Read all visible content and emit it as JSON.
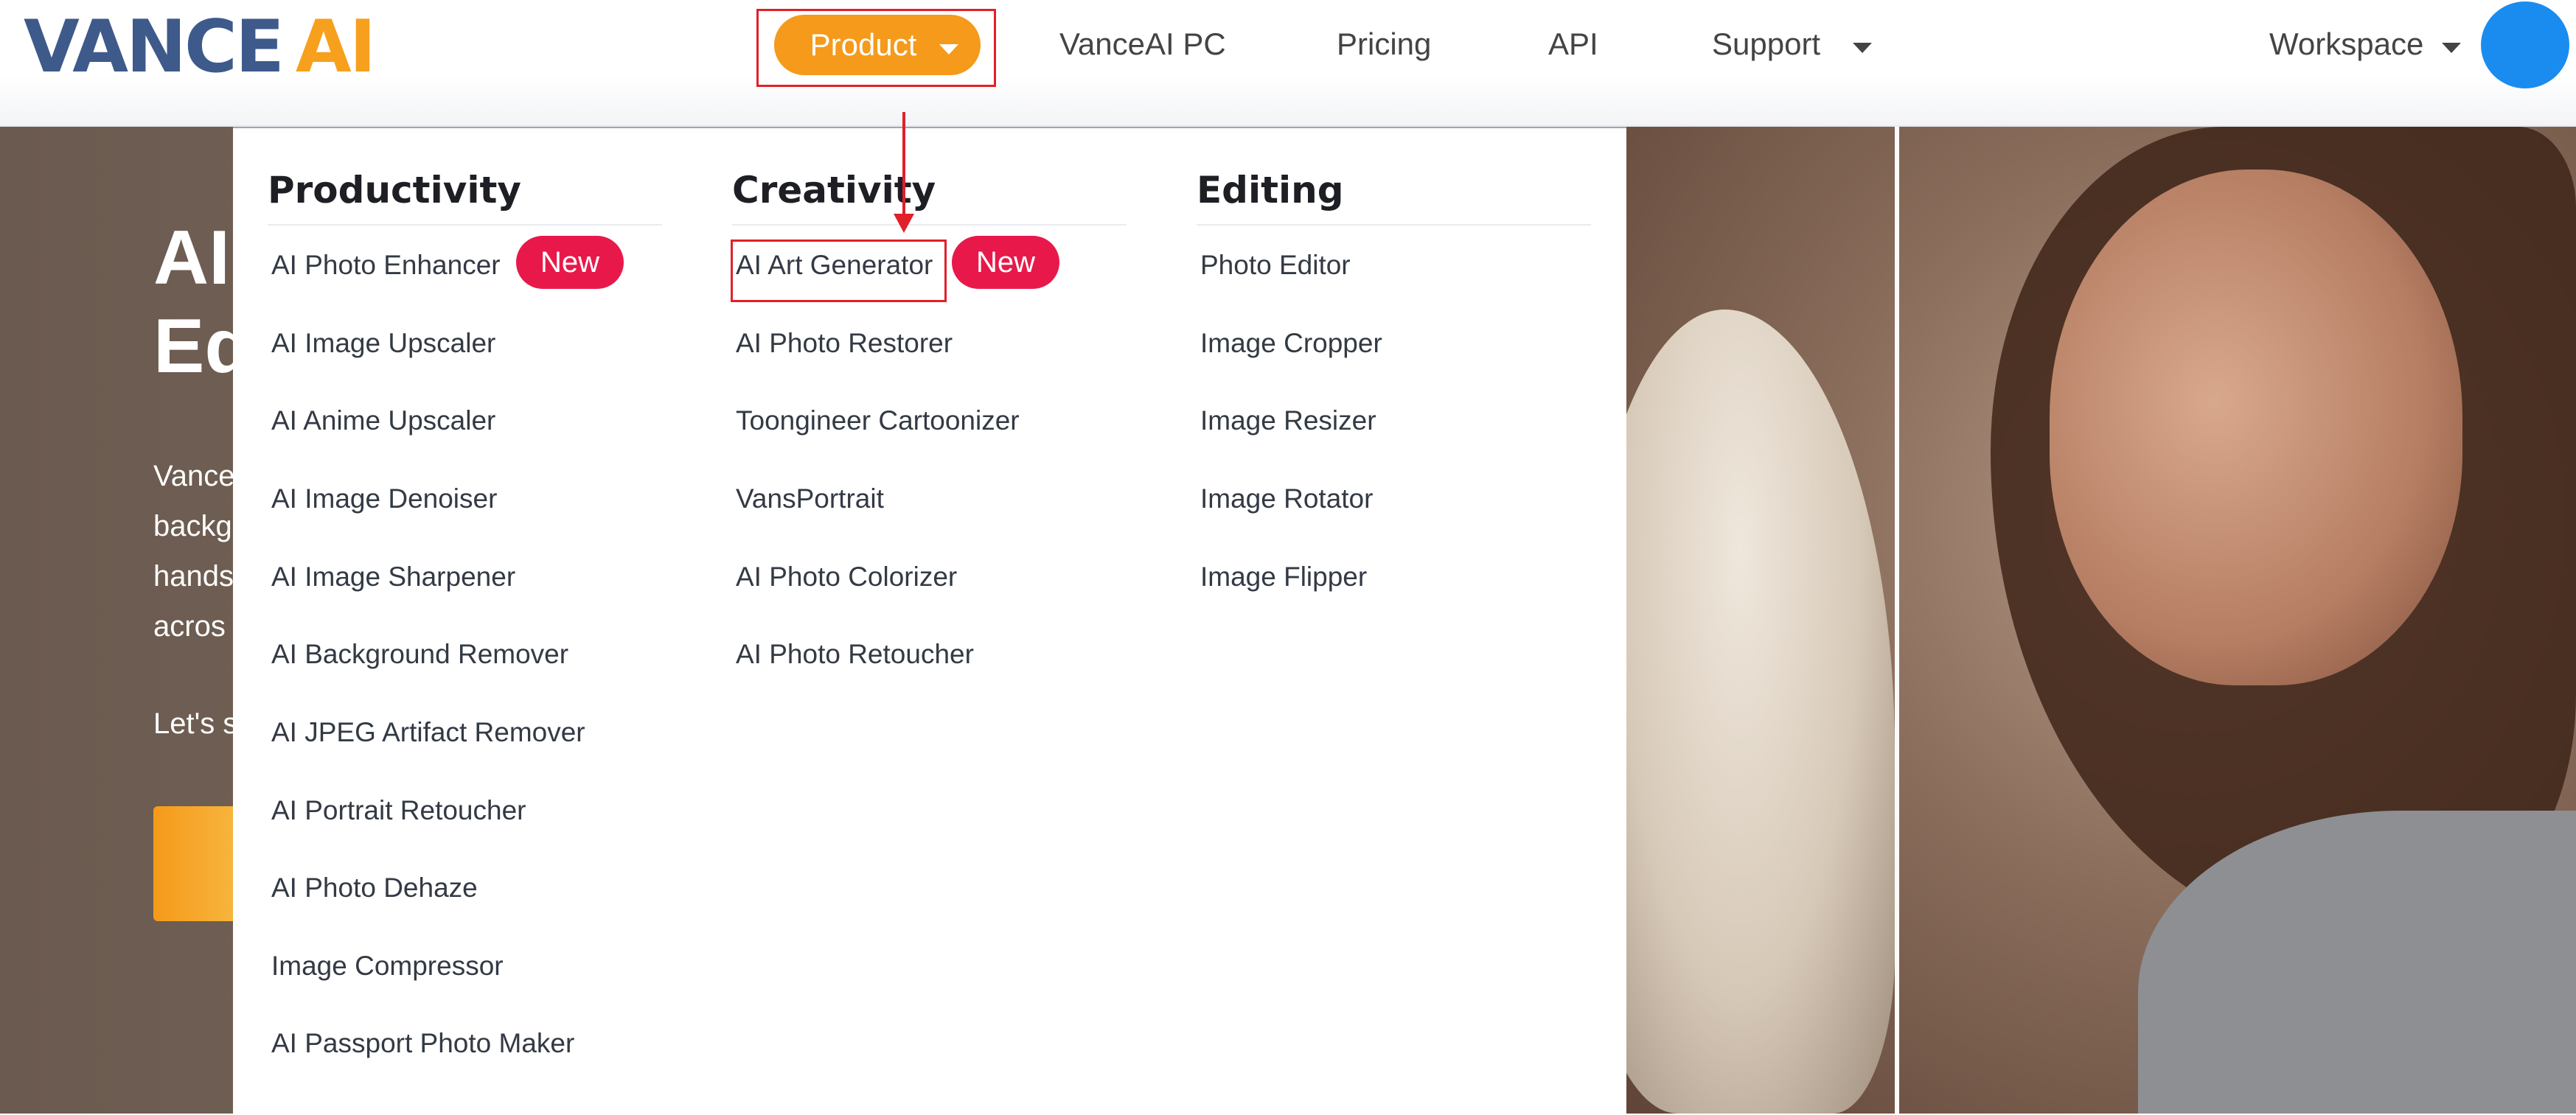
{
  "brand": {
    "logo_part1": "VANCE",
    "logo_part2": "AI"
  },
  "nav": {
    "product": "Product",
    "vanceai_pc": "VanceAI PC",
    "pricing": "Pricing",
    "api": "API",
    "support": "Support",
    "workspace": "Workspace"
  },
  "hero": {
    "title_line1": "AI",
    "title_line2": "Ed",
    "body_lines": [
      "Vance",
      "backg",
      "hands",
      "acros"
    ],
    "lets": "Let's s"
  },
  "dropdown": {
    "productivity": {
      "heading": "Productivity",
      "items": [
        "AI Photo Enhancer",
        "AI Image Upscaler",
        "AI Anime Upscaler",
        "AI Image Denoiser",
        "AI Image Sharpener",
        "AI Background Remover",
        "AI JPEG Artifact Remover",
        "AI Portrait Retoucher",
        "AI Photo Dehaze",
        "Image Compressor",
        "AI Passport Photo Maker"
      ],
      "badge": "New"
    },
    "creativity": {
      "heading": "Creativity",
      "items": [
        "AI Art Generator",
        "AI Photo Restorer",
        "Toongineer Cartoonizer",
        "VansPortrait",
        "AI Photo Colorizer",
        "AI Photo Retoucher"
      ],
      "badge": "New"
    },
    "editing": {
      "heading": "Editing",
      "items": [
        "Photo Editor",
        "Image Cropper",
        "Image Resizer",
        "Image Rotator",
        "Image Flipper"
      ]
    }
  },
  "colors": {
    "accent_orange": "#f59a1a",
    "badge_red": "#e8194a",
    "highlight_red": "#e0202a",
    "avatar_blue": "#1a8cf0",
    "logo_blue": "#3d5a8a"
  }
}
